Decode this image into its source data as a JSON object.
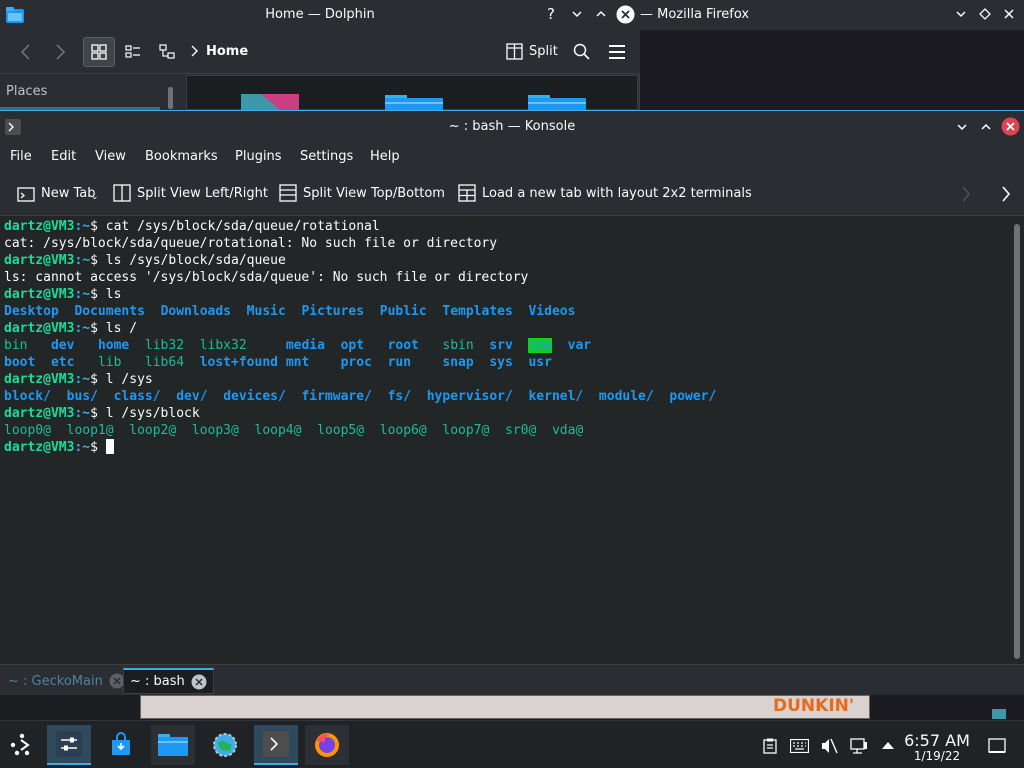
{
  "dolphin": {
    "title": "Home — Dolphin",
    "breadcrumb": "Home",
    "split_label": "Split",
    "places_label": "Places"
  },
  "firefox": {
    "title": "— Mozilla Firefox"
  },
  "konsole": {
    "title": "~ : bash — Konsole",
    "menu": [
      "File",
      "Edit",
      "View",
      "Bookmarks",
      "Plugins",
      "Settings",
      "Help"
    ],
    "toolbar": {
      "new_tab": "New Tab",
      "split_lr": "Split View Left/Right",
      "split_tb": "Split View Top/Bottom",
      "load_layout": "Load a new tab with layout 2x2 terminals"
    },
    "prompt_user": "dartz@VM3",
    "prompt_path": ":~",
    "prompt_symbol": "$",
    "commands": [
      " cat /sys/block/sda/queue/rotational",
      " ls /sys/block/sda/queue",
      " ls",
      " ls /",
      " l /sys",
      " l /sys/block"
    ],
    "outputs": {
      "cat_err": "cat: /sys/block/sda/queue/rotational: No such file or directory",
      "ls_err": "ls: cannot access '/sys/block/sda/queue': No such file or directory"
    },
    "home_dirs": [
      "Desktop",
      "Documents",
      "Downloads",
      "Music",
      "Pictures",
      "Public",
      "Templates",
      "Videos"
    ],
    "root_row1": [
      "bin",
      "dev",
      "home",
      "lib32",
      "libx32",
      "media",
      "opt",
      "root",
      "sbin",
      "srv",
      "tmp",
      "var"
    ],
    "root_row2": [
      "boot",
      "etc",
      "lib",
      "lib64",
      "lost+found",
      "mnt",
      "proc",
      "run",
      "snap",
      "sys",
      "usr"
    ],
    "sys_dirs": [
      "block/",
      "bus/",
      "class/",
      "dev/",
      "devices/",
      "firmware/",
      "fs/",
      "hypervisor/",
      "kernel/",
      "module/",
      "power/"
    ],
    "block_links": [
      "loop0@",
      "loop1@",
      "loop2@",
      "loop3@",
      "loop4@",
      "loop5@",
      "loop6@",
      "loop7@",
      "sr0@",
      "vda@"
    ],
    "tabs": [
      {
        "label": "~ : GeckoMain",
        "active": false
      },
      {
        "label": "~ : bash",
        "active": true
      }
    ]
  },
  "background_text": "DUNKIN'",
  "taskbar": {
    "time": "6:57 AM",
    "date": "1/19/22"
  },
  "colors": {
    "accent": "#3daee9",
    "prompt_user": "#1cdc9a",
    "directory": "#1d99f3",
    "symlink": "#1abc9c",
    "close_red": "#da4453"
  }
}
